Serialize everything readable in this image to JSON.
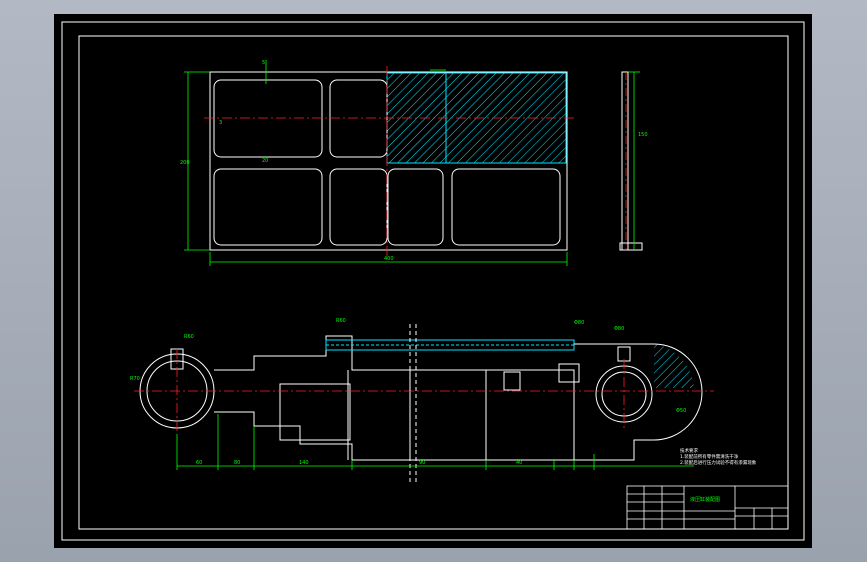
{
  "viewer": {
    "background": "#a2a9b5",
    "canvas_color": "#000000",
    "line_color": "#ffffff",
    "dimension_color": "#00ff00",
    "centerline_color": "#ff0000",
    "hatch_color": "#00ffff"
  },
  "drawing": {
    "title_label": "液压缸装配图",
    "notes": {
      "heading": "技术要求",
      "line1": "1.装配前所有零件需清洗干净",
      "line2": "2.装配后进行压力试验不得有渗漏现象"
    },
    "dims": {
      "plate_width": "400",
      "plate_height": "200",
      "gap_top": "5",
      "gap_left": "3",
      "rib": "20",
      "side_height": "150",
      "cyl_len_1": "60",
      "cyl_len_2": "80",
      "cyl_len_3": "140",
      "cyl_len_4": "90",
      "cyl_len_5": "40",
      "bore": "Φ80",
      "eye": "R60"
    },
    "callouts": [
      "R60",
      "Φ80",
      "R70",
      "Φ50"
    ]
  }
}
